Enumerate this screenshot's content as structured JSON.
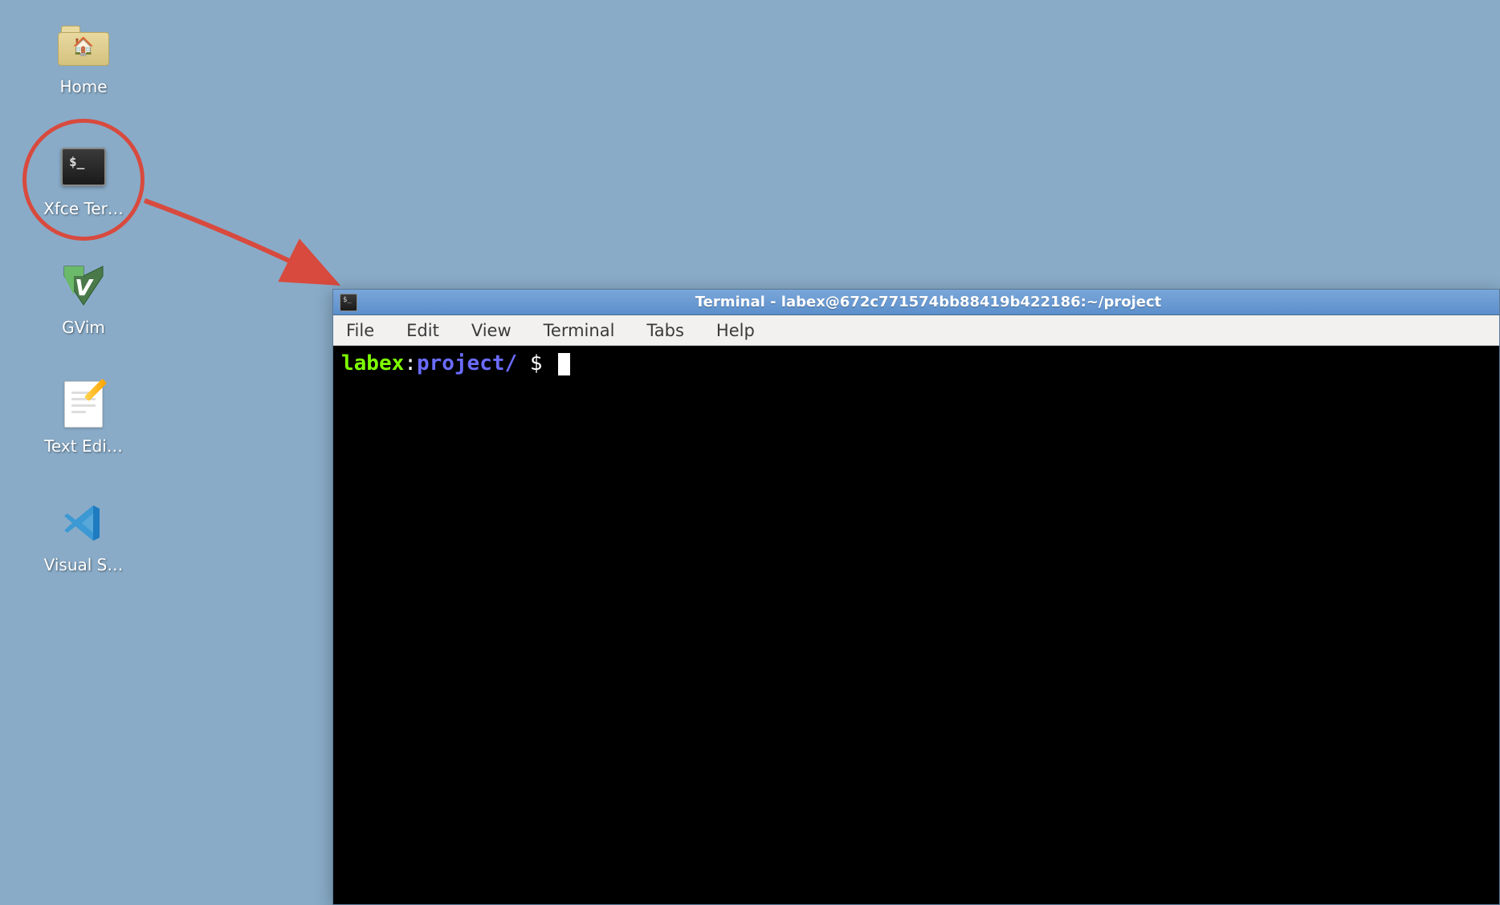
{
  "desktop": {
    "icons": [
      {
        "id": "home",
        "label": "Home"
      },
      {
        "id": "xfce-terminal",
        "label": "Xfce Ter…"
      },
      {
        "id": "gvim",
        "label": "GVim"
      },
      {
        "id": "text-editor",
        "label": "Text Edi…"
      },
      {
        "id": "visual-studio",
        "label": "Visual S…"
      }
    ]
  },
  "annotation": {
    "circle_target": "xfce-terminal",
    "arrow": true,
    "arrow_color": "#D84A3E"
  },
  "terminal": {
    "title": "Terminal - labex@672c771574bb88419b422186:~/project",
    "menu": [
      "File",
      "Edit",
      "View",
      "Terminal",
      "Tabs",
      "Help"
    ],
    "prompt": {
      "user": "labex",
      "separator": ":",
      "path": "project/",
      "symbol": "$"
    }
  }
}
